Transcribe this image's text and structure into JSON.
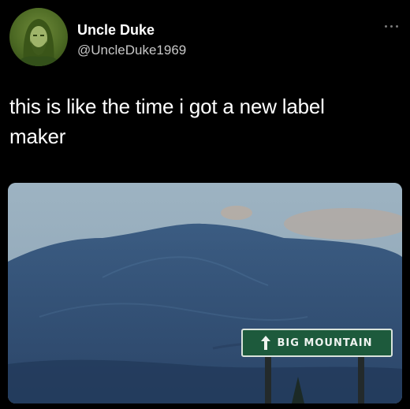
{
  "author": {
    "name": "Uncle Duke",
    "handle": "@UncleDuke1969"
  },
  "tweet": {
    "text_line1": "this is like the time i got a new label",
    "text_line2": "maker"
  },
  "icons": {
    "more": "more-horizontal-icon",
    "sign_arrow": "arrow-up-icon"
  },
  "media": {
    "sign_text": "BIG MOUNTAIN"
  },
  "colors": {
    "background": "#000000",
    "sign_green": "#1d5a3c",
    "handle_gray": "#c8c8c8"
  }
}
